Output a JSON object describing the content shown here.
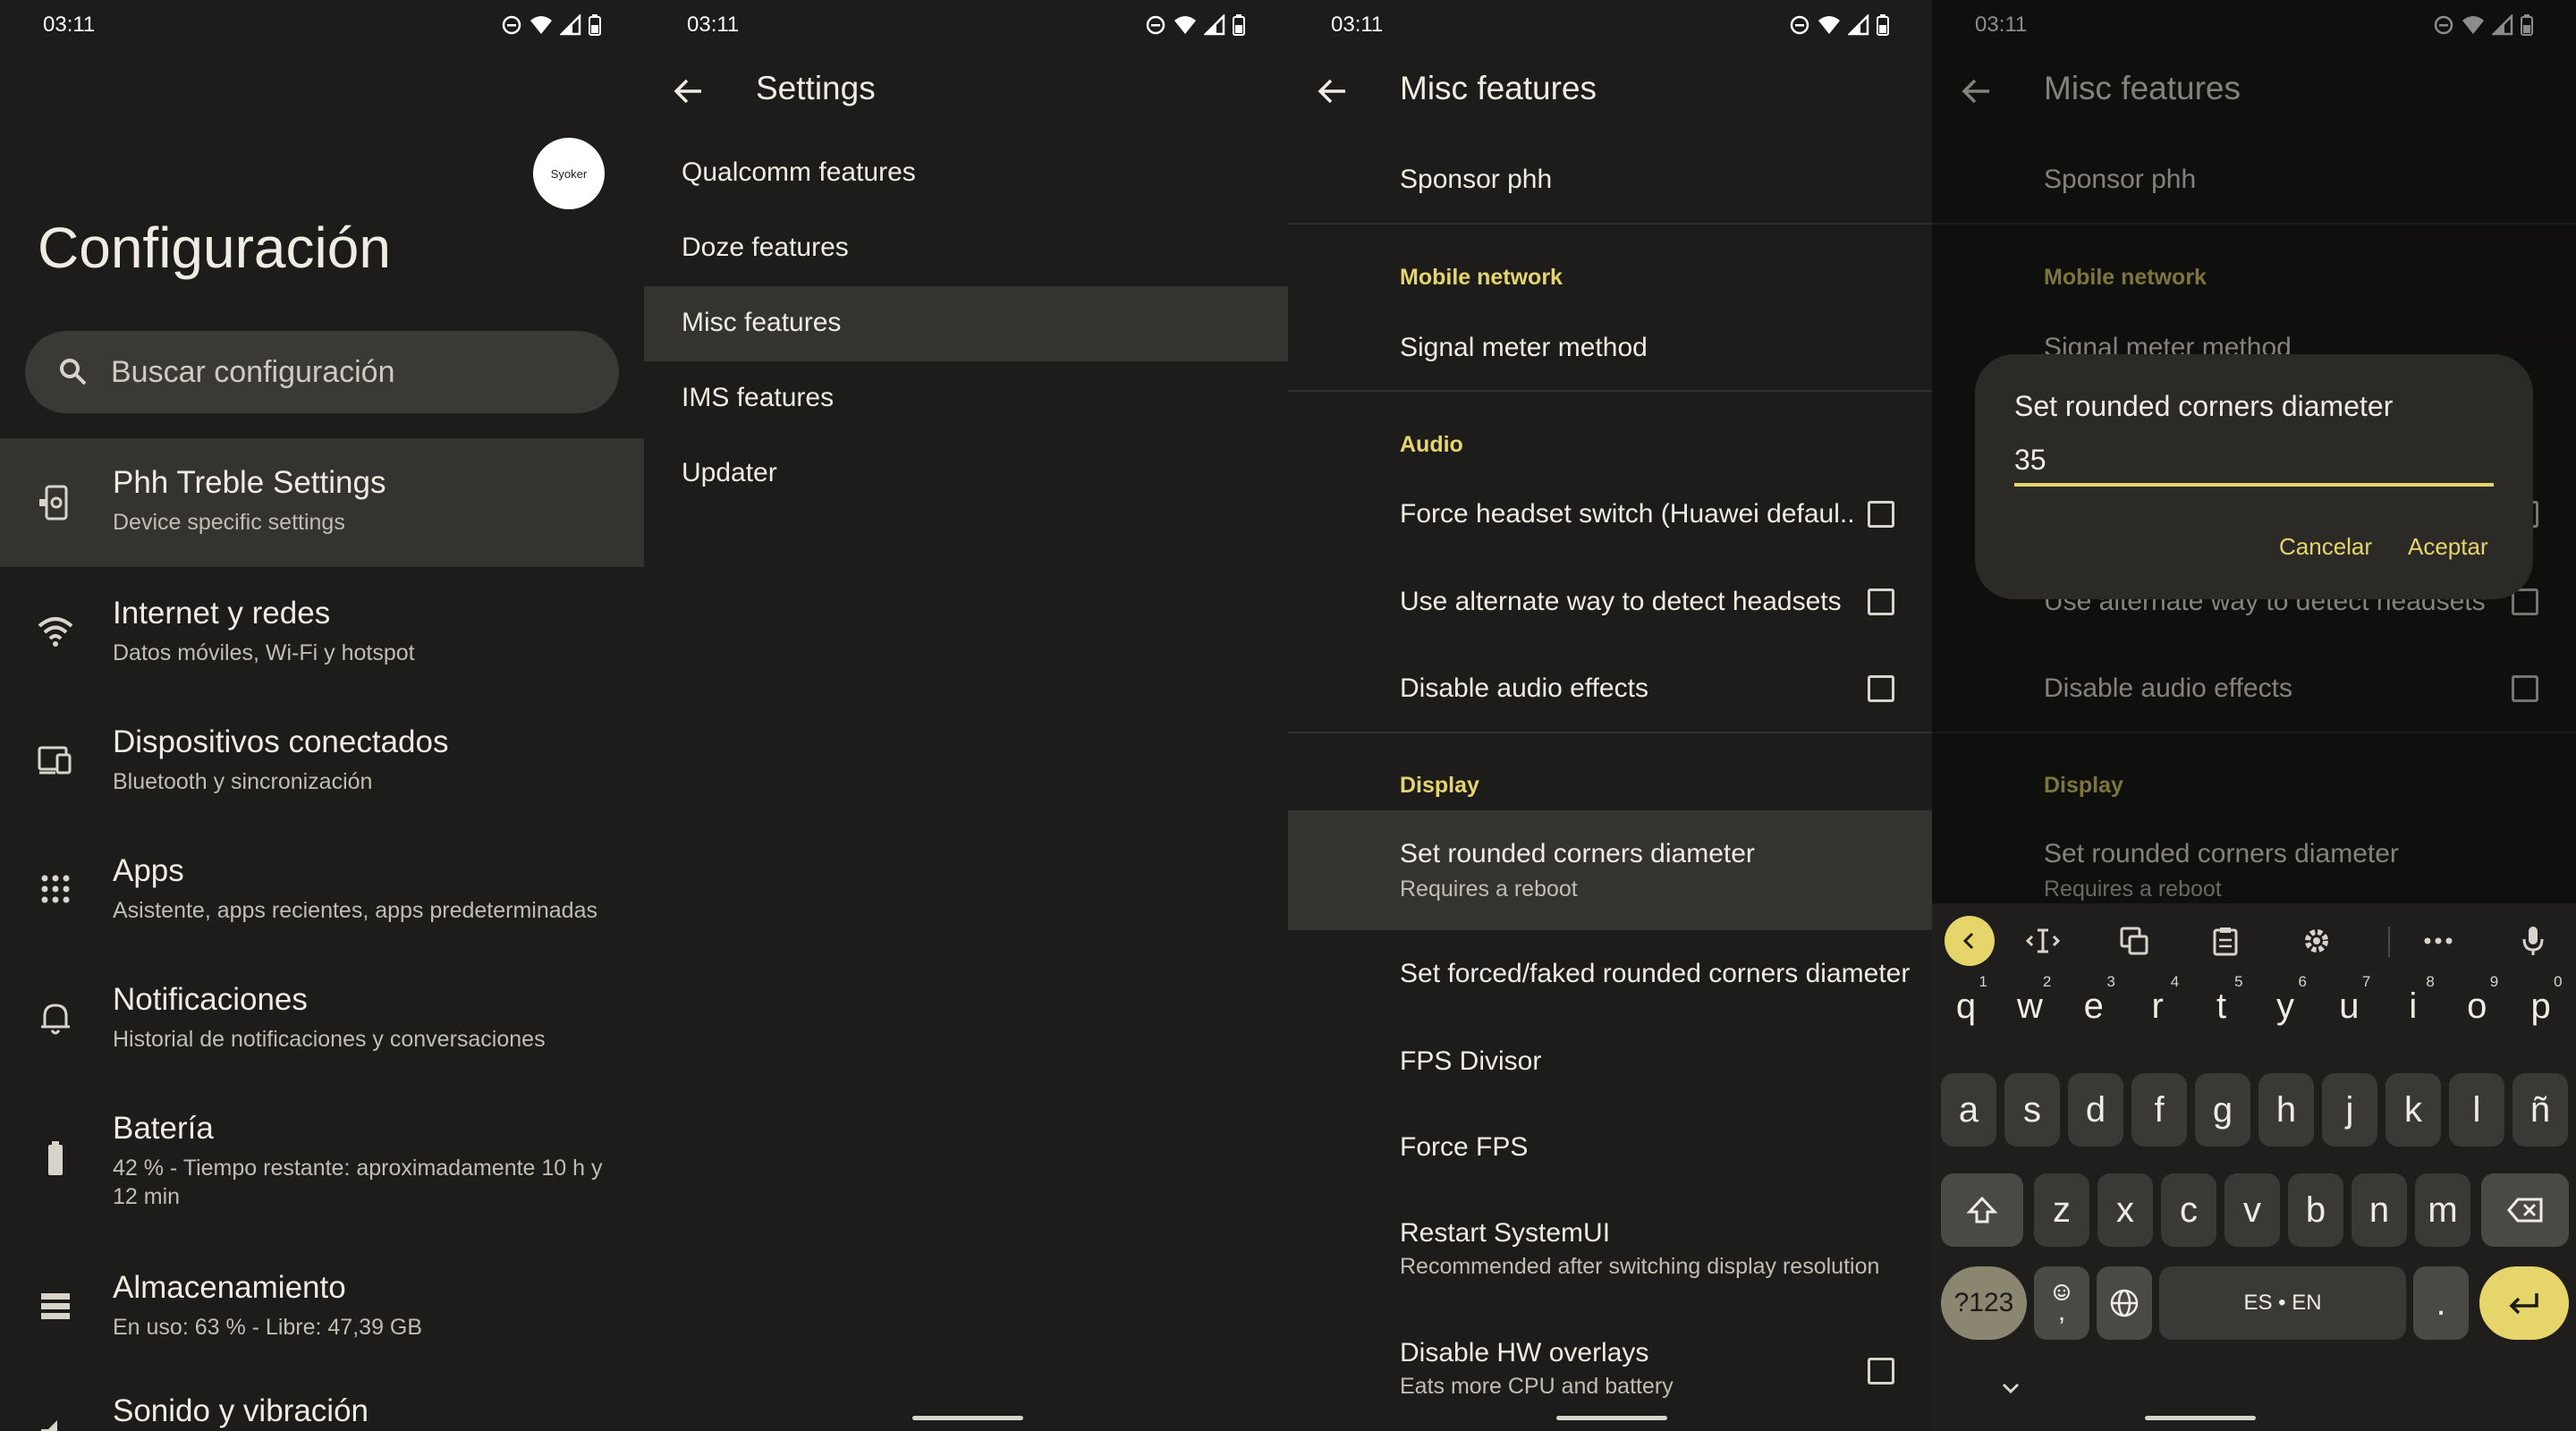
{
  "status_time": "03:11",
  "screen1": {
    "avatar_text": "Syoker",
    "title": "Configuración",
    "search_placeholder": "Buscar configuración",
    "items": [
      {
        "title": "Phh Treble Settings",
        "subtitle": "Device specific settings",
        "icon": "phone-settings-icon"
      },
      {
        "title": "Internet y redes",
        "subtitle": "Datos móviles, Wi-Fi y hotspot",
        "icon": "wifi-icon"
      },
      {
        "title": "Dispositivos conectados",
        "subtitle": "Bluetooth y sincronización",
        "icon": "devices-icon"
      },
      {
        "title": "Apps",
        "subtitle": "Asistente, apps recientes, apps predeterminadas",
        "icon": "apps-grid-icon"
      },
      {
        "title": "Notificaciones",
        "subtitle": "Historial de notificaciones y conversaciones",
        "icon": "bell-icon"
      },
      {
        "title": "Batería",
        "subtitle": "42 % - Tiempo restante: aproximadamente 10 h y 12 min",
        "icon": "battery-icon"
      },
      {
        "title": "Almacenamiento",
        "subtitle": "En uso: 63 % - Libre: 47,39 GB",
        "icon": "storage-icon"
      },
      {
        "title": "Sonido y vibración",
        "subtitle": "",
        "icon": "volume-icon"
      }
    ]
  },
  "screen2": {
    "title": "Settings",
    "items": [
      "Qualcomm features",
      "Doze features",
      "Misc features",
      "IMS features",
      "Updater"
    ]
  },
  "screen3": {
    "title": "Misc features",
    "sponsor": "Sponsor phh",
    "cat_mobile": "Mobile network",
    "signal": "Signal meter method",
    "cat_audio": "Audio",
    "audio_items": [
      "Force headset switch (Huawei defaul..",
      "Use alternate way to detect headsets",
      "Disable audio effects"
    ],
    "cat_display": "Display",
    "rounded_title": "Set rounded corners diameter",
    "rounded_sub": "Requires a reboot",
    "forced_rounded": "Set forced/faked rounded corners diameter",
    "fps_divisor": "FPS Divisor",
    "force_fps": "Force FPS",
    "restart_title": "Restart SystemUI",
    "restart_sub": "Recommended after switching display resolution",
    "hw_title": "Disable HW overlays",
    "hw_sub": "Eats more CPU and battery"
  },
  "screen4": {
    "title": "Misc features",
    "dialog_title": "Set rounded corners diameter",
    "dialog_value": "35",
    "cancel": "Cancelar",
    "accept": "Aceptar",
    "signal_partial": "Signal meter method",
    "alt_partial": "Use alternate way to detect headsets"
  },
  "keyboard": {
    "row1": [
      [
        "q",
        "1"
      ],
      [
        "w",
        "2"
      ],
      [
        "e",
        "3"
      ],
      [
        "r",
        "4"
      ],
      [
        "t",
        "5"
      ],
      [
        "y",
        "6"
      ],
      [
        "u",
        "7"
      ],
      [
        "i",
        "8"
      ],
      [
        "o",
        "9"
      ],
      [
        "p",
        "0"
      ]
    ],
    "row2": [
      "a",
      "s",
      "d",
      "f",
      "g",
      "h",
      "j",
      "k",
      "l",
      "ñ"
    ],
    "row3": [
      "z",
      "x",
      "c",
      "v",
      "b",
      "n",
      "m"
    ],
    "symbols": "?123",
    "comma": ",",
    "space": "ES • EN",
    "period": "."
  },
  "colors": {
    "accent": "#e6d56a",
    "background": "#1d1c1a",
    "highlight": "#34332f"
  }
}
